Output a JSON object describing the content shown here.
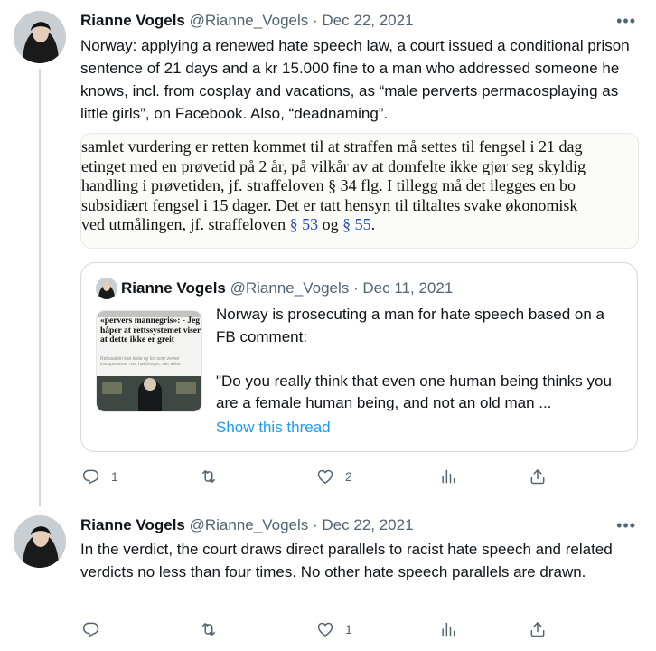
{
  "tweets": [
    {
      "name": "Rianne Vogels",
      "handle": "@Rianne_Vogels",
      "separator": "·",
      "date": "Dec 22, 2021",
      "more": "•••",
      "text": "Norway: applying a renewed hate speech law, a court issued a conditional prison sentence of 21 days and a kr 15.000 fine to a man who addressed someone he knows, incl. from cosplay and vacations, as “male perverts permacosplaying as little girls”, on Facebook. Also, “deadnaming”.",
      "image_lines": [
        "samlet vurdering er retten kommet til at straffen må settes til fengsel i 21 dag",
        "etinget med en prøvetid på 2 år, på vilkår av at domfelte ikke gjør seg skyldig",
        "handling i prøvetiden, jf. straffeloven § 34 flg. I tillegg må det ilegges en bo",
        "subsidiært fengsel i 15 dager. Det er tatt hensyn til tiltaltes svake økonomisk",
        "ved utmålingen, jf. straffeloven",
        "§ 53",
        "og",
        "§ 55",
        "."
      ],
      "quote": {
        "name": "Rianne Vogels",
        "handle": "@Rianne_Vogels",
        "separator": "·",
        "date": "Dec 11, 2021",
        "thumb_headline": "«pervers mannegris»: - Jeg håper at rettssystemet viser at dette ikke er greit",
        "thumb_sub": "Rettssaken kan teste ny lov som verner transpersoner mot hatytringer, sier aktor.",
        "text_1": "Norway is prosecuting a man for hate speech based on a FB comment:",
        "text_2": "\"Do you really think that even one human being thinks you are a female human being, and not an old man ...",
        "show_thread": "Show this thread"
      },
      "actions": {
        "replies": "1",
        "retweets": "",
        "likes": "2"
      }
    },
    {
      "name": "Rianne Vogels",
      "handle": "@Rianne_Vogels",
      "separator": "·",
      "date": "Dec 22, 2021",
      "more": "•••",
      "text": "In the verdict, the court draws direct parallels to racist hate speech and related verdicts no less than four times. No other hate speech parallels are drawn.",
      "actions": {
        "replies": "",
        "retweets": "",
        "likes": "1"
      }
    }
  ],
  "colors": {
    "text": "#0f1419",
    "secondary": "#536471",
    "accent": "#1d9bf0",
    "border": "#cfd9de"
  },
  "icons": [
    "reply-icon",
    "retweet-icon",
    "like-icon",
    "analytics-icon",
    "share-icon",
    "more-icon"
  ]
}
